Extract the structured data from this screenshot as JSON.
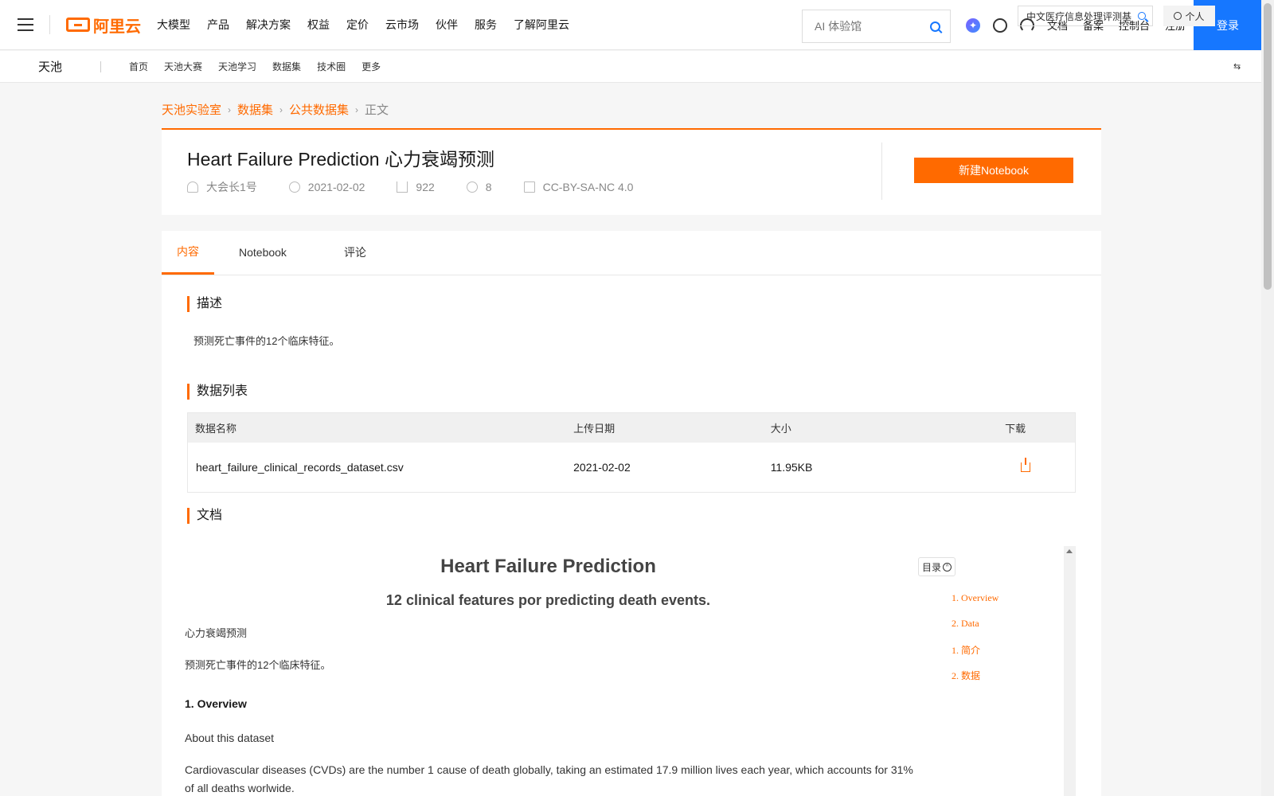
{
  "topnav": {
    "logo_text": "阿里云",
    "items": [
      "大模型",
      "产品",
      "解决方案",
      "权益",
      "定价",
      "云市场",
      "伙伴",
      "服务",
      "了解阿里云"
    ],
    "search_placeholder": "AI 体验馆",
    "links": [
      "文档",
      "备案",
      "控制台",
      "注册"
    ],
    "login_label": "登录",
    "icons": [
      "spark-icon",
      "gauge-icon",
      "headset-icon"
    ]
  },
  "subnav": {
    "brand": "天池",
    "items": [
      "首页",
      "天池大赛",
      "天池学习",
      "数据集",
      "技术圈",
      "更多"
    ],
    "search_value": "中文医疗信息处理评测基",
    "personal_label": "个人"
  },
  "breadcrumb": {
    "items": [
      "天池实验室",
      "数据集",
      "公共数据集"
    ],
    "current": "正文"
  },
  "dataset": {
    "title": "Heart Failure Prediction 心力衰竭预测",
    "author": "大会长1号",
    "date": "2021-02-02",
    "downloads": "922",
    "shares": "8",
    "license": "CC-BY-SA-NC 4.0",
    "notebook_button": "新建Notebook"
  },
  "tabs": [
    "内容",
    "Notebook",
    "评论"
  ],
  "sections": {
    "description_title": "描述",
    "description_text": "预测死亡事件的12个临床特征。",
    "datalist_title": "数据列表",
    "docs_title": "文档"
  },
  "table": {
    "headers": [
      "数据名称",
      "上传日期",
      "大小",
      "下载"
    ],
    "rows": [
      {
        "name": "heart_failure_clinical_records_dataset.csv",
        "date": "2021-02-02",
        "size": "11.95KB"
      }
    ]
  },
  "doc": {
    "h1": "Heart Failure Prediction",
    "h2": "12 clinical features por predicting death events.",
    "p1": "心力衰竭预测",
    "p2": "预测死亡事件的12个临床特征。",
    "h3": "1. Overview",
    "p3": "About this dataset",
    "p4": "Cardiovascular diseases (CVDs) are the number 1 cause of death globally, taking an estimated 17.9 million lives each year, which accounts for 31% of all deaths worlwide.",
    "toc_label": "目录",
    "toc": [
      "1. Overview",
      "2. Data",
      "1. 简介",
      "2. 数据"
    ]
  }
}
